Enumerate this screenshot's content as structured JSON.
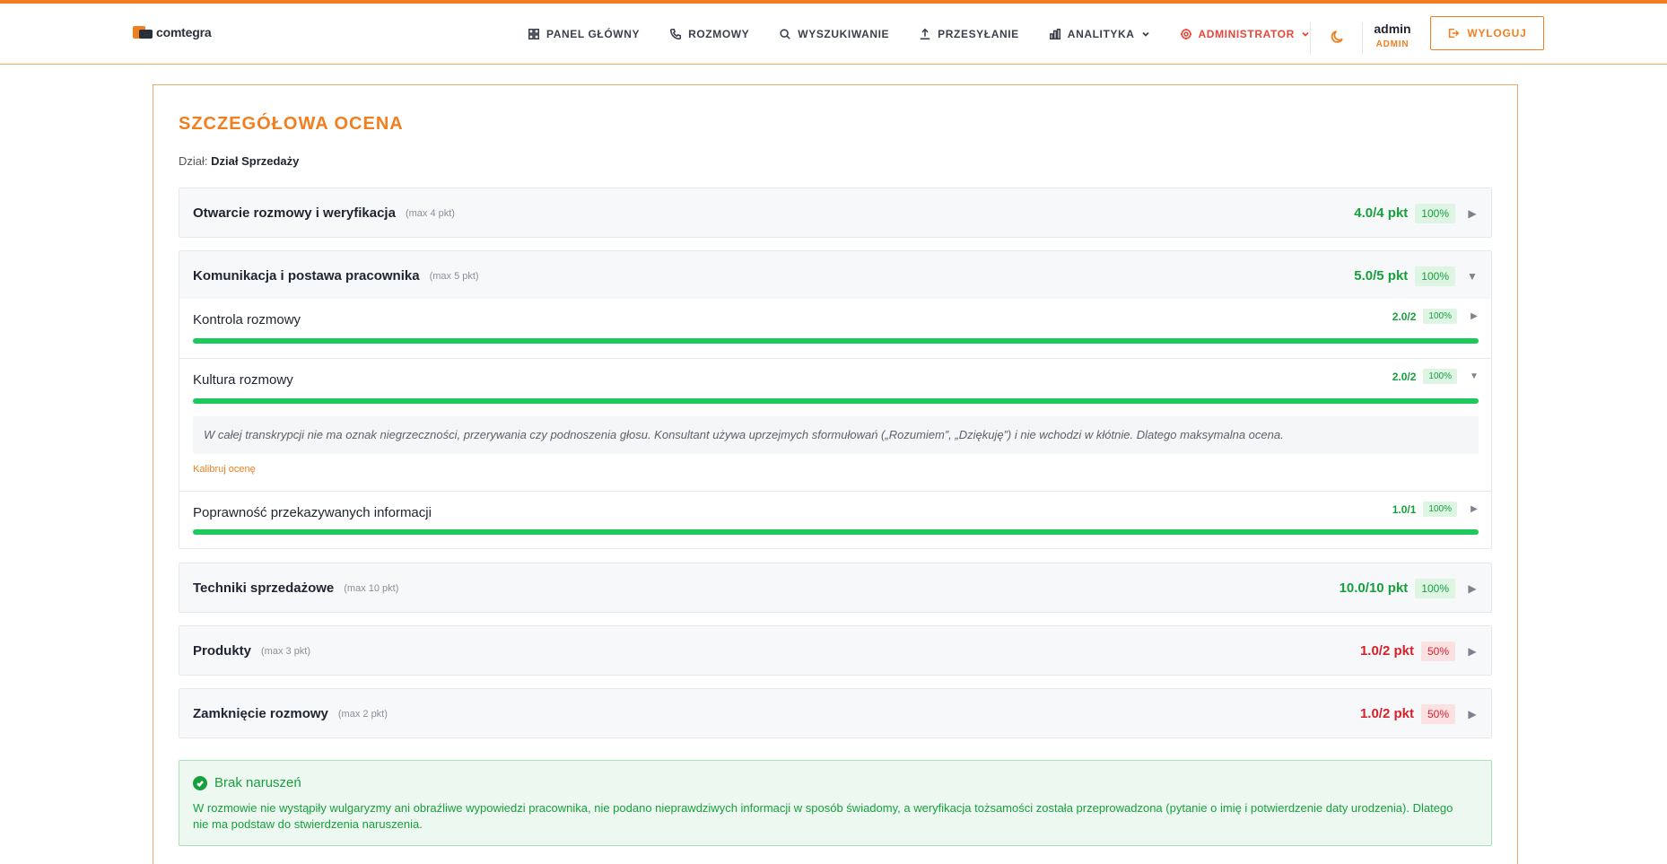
{
  "app": {
    "logo_text": "comtegra"
  },
  "nav": {
    "items": [
      {
        "label": "PANEL GŁÓWNY",
        "icon": "grid-icon"
      },
      {
        "label": "ROZMOWY",
        "icon": "phone-icon"
      },
      {
        "label": "WYSZUKIWANIE",
        "icon": "search-icon"
      },
      {
        "label": "PRZESYŁANIE",
        "icon": "upload-icon"
      },
      {
        "label": "ANALITYKA",
        "icon": "bar-chart-icon"
      },
      {
        "label": "ADMINISTRATOR",
        "icon": "gear-icon"
      }
    ],
    "user_name": "admin",
    "user_role": "ADMIN",
    "logout_label": "WYLOGUJ"
  },
  "page": {
    "title": "SZCZEGÓŁOWA OCENA",
    "dept_label": "Dział:",
    "dept_value": "Dział Sprzedaży"
  },
  "sections": [
    {
      "title": "Otwarcie rozmowy i weryfikacja",
      "max": "(max 4 pkt)",
      "score": "4.0/4 pkt",
      "pct": "100%",
      "status": "good",
      "expanded": false
    },
    {
      "title": "Komunikacja i postawa pracownika",
      "max": "(max 5 pkt)",
      "score": "5.0/5 pkt",
      "pct": "100%",
      "status": "good",
      "expanded": true,
      "subs": [
        {
          "title": "Kontrola rozmowy",
          "score": "2.0/2",
          "pct": "100%",
          "fill": 1.0,
          "expanded": false
        },
        {
          "title": "Kultura rozmowy",
          "score": "2.0/2",
          "pct": "100%",
          "fill": 1.0,
          "expanded": true,
          "comment": "W całej transkrypcji nie ma oznak niegrzeczności, przerywania czy podnoszenia głosu. Konsultant używa uprzejmych sformułowań („Rozumiem”, „Dziękuję”) i nie wchodzi w kłótnie. Dlatego maksymalna ocena.",
          "calibrate_label": "Kalibruj ocenę"
        },
        {
          "title": "Poprawność przekazywanych informacji",
          "score": "1.0/1",
          "pct": "100%",
          "fill": 1.0,
          "expanded": false
        }
      ]
    },
    {
      "title": "Techniki sprzedażowe",
      "max": "(max 10 pkt)",
      "score": "10.0/10 pkt",
      "pct": "100%",
      "status": "good",
      "expanded": false
    },
    {
      "title": "Produkty",
      "max": "(max 3 pkt)",
      "score": "1.0/2 pkt",
      "pct": "50%",
      "status": "bad",
      "expanded": false
    },
    {
      "title": "Zamknięcie rozmowy",
      "max": "(max 2 pkt)",
      "score": "1.0/2 pkt",
      "pct": "50%",
      "status": "bad",
      "expanded": false
    }
  ],
  "violation": {
    "title": "Brak naruszeń",
    "text": "W rozmowie nie wystąpiły wulgaryzmy ani obraźliwe wypowiedzi pracownika, nie podano nieprawdziwych informacji w sposób świadomy, a weryfikacja tożsamości została przeprowadzona (pytanie o imię i potwierdzenie daty urodzenia). Dlatego nie ma podstaw do stwierdzenia naruszenia."
  },
  "colors": {
    "accent": "#f07f1f",
    "good": "#16a03c",
    "bad": "#d6202a",
    "admin": "#e8483a"
  }
}
